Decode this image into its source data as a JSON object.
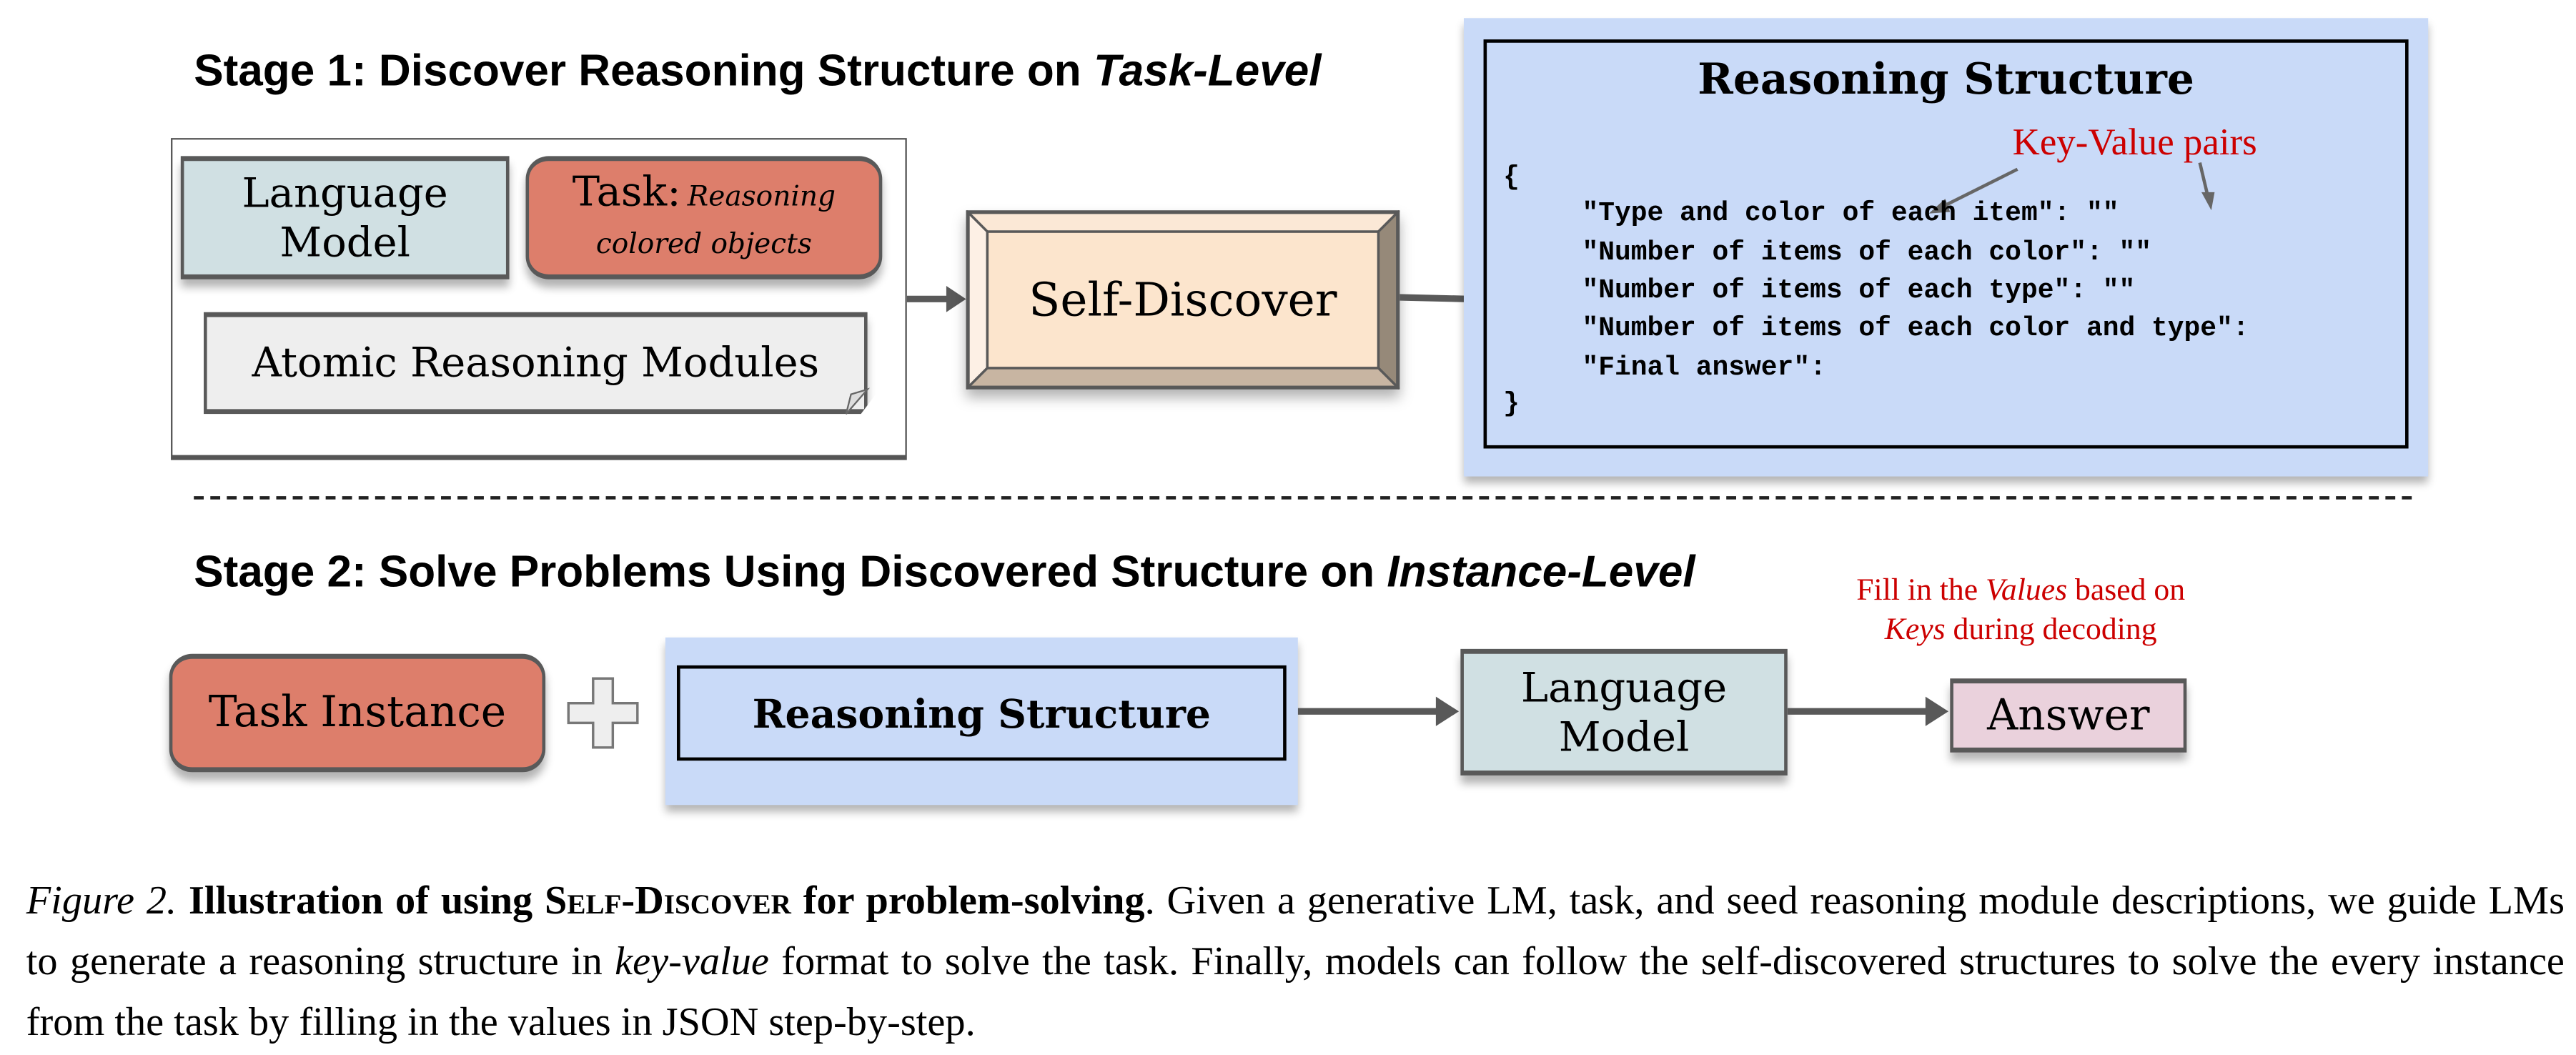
{
  "stage1": {
    "title_prefix": "Stage 1: Discover Reasoning Structure on ",
    "title_em": "Task-Level",
    "language_model": [
      "Language",
      "Model"
    ],
    "task_label": "Task:",
    "task_desc": [
      "Reasoning",
      "colored objects"
    ],
    "atomic_modules": "Atomic Reasoning Modules",
    "self_discover": "Self-Discover",
    "reasoning_structure": {
      "title": "Reasoning Structure",
      "annotation": "Key-Value pairs",
      "open_brace": "{",
      "lines": [
        "\"Type and color of each item\": \"\"",
        "\"Number of items of each color\": \"\"",
        "\"Number of items of each type\": \"\"",
        "\"Number of items of each color and type\":",
        "\"Final answer\":"
      ],
      "close_brace": "}"
    }
  },
  "stage2": {
    "title_prefix": "Stage 2: Solve Problems Using Discovered Structure on ",
    "title_em": "Instance-Level",
    "annotation": {
      "line1_pre": "Fill in the ",
      "line1_em": "Values",
      "line1_post": " based on",
      "line2_em": "Keys",
      "line2_post": " during decoding"
    },
    "task_instance": "Task Instance",
    "reasoning_structure": "Reasoning Structure",
    "language_model": [
      "Language",
      "Model"
    ],
    "answer": "Answer"
  },
  "caption": {
    "label": "Figure 2.",
    "title_pre": "Illustration of using ",
    "title_name": "Self-Discover",
    "title_post": " for problem-solving",
    "body1": ". Given a generative LM, task, and seed reasoning module descriptions, we guide LMs to generate a reasoning structure in ",
    "body_em": "key-value",
    "body2": " format to solve the task. Finally, models can follow the self-discovered structures to solve the every instance from the task by filling in the values in JSON step-by-step."
  },
  "colors": {
    "language_model": "#d0e0e3",
    "task": "#dd7e6b",
    "atomic": "#eeeeee",
    "self_discover": "#fce5cd",
    "reasoning_structure": "#c9daf8",
    "answer": "#ead1dc",
    "annotation": "#cc0000"
  }
}
